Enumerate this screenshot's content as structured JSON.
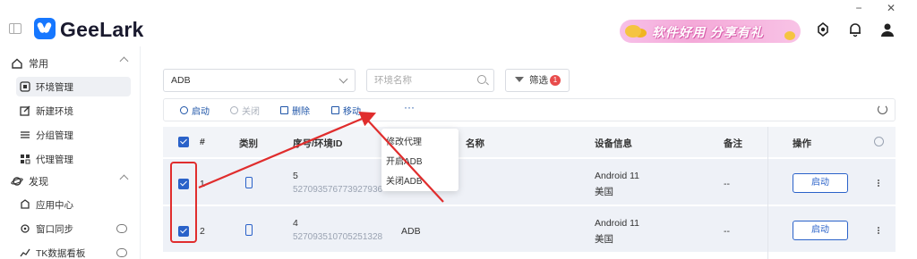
{
  "app": {
    "brand": "GeeLark"
  },
  "topbar": {
    "promo_text": "软件好用 分享有礼",
    "window_minimize": "−",
    "window_close": "✕"
  },
  "sidebar": {
    "groups": [
      {
        "label": "常用",
        "items": [
          {
            "label": "环境管理",
            "active": true
          },
          {
            "label": "新建环境"
          },
          {
            "label": "分组管理"
          },
          {
            "label": "代理管理"
          }
        ]
      },
      {
        "label": "发现",
        "items": [
          {
            "label": "应用中心"
          },
          {
            "label": "窗口同步"
          },
          {
            "label": "TK数据看板"
          }
        ]
      }
    ]
  },
  "filters": {
    "select_value": "ADB",
    "search_placeholder": "环境名称",
    "filter_label": "筛选",
    "filter_count": "1"
  },
  "toolbar": {
    "start": "启动",
    "close": "关闭",
    "delete": "删除",
    "move": "移动",
    "more": "···"
  },
  "table": {
    "headers": {
      "index": "#",
      "type": "类别",
      "serial": "序号/环境ID",
      "name": "名称",
      "device": "设备信息",
      "remark": "备注",
      "actions": "操作"
    },
    "rows": [
      {
        "index": "1",
        "serial": "5",
        "env_id": "527093576773927936",
        "name": "",
        "device": "Android 11",
        "region": "美国",
        "remark": "--",
        "action": "启动"
      },
      {
        "index": "2",
        "serial": "4",
        "env_id": "527093510705251328",
        "name": "ADB",
        "device": "Android 11",
        "region": "美国",
        "remark": "--",
        "action": "启动"
      }
    ]
  },
  "dropdown": {
    "items": [
      "修改代理",
      "开启ADB",
      "关闭ADB"
    ]
  },
  "colors": {
    "accent": "#1f55a8",
    "annotation_red": "#e02d2d",
    "brand_blue": "#1677ff"
  }
}
